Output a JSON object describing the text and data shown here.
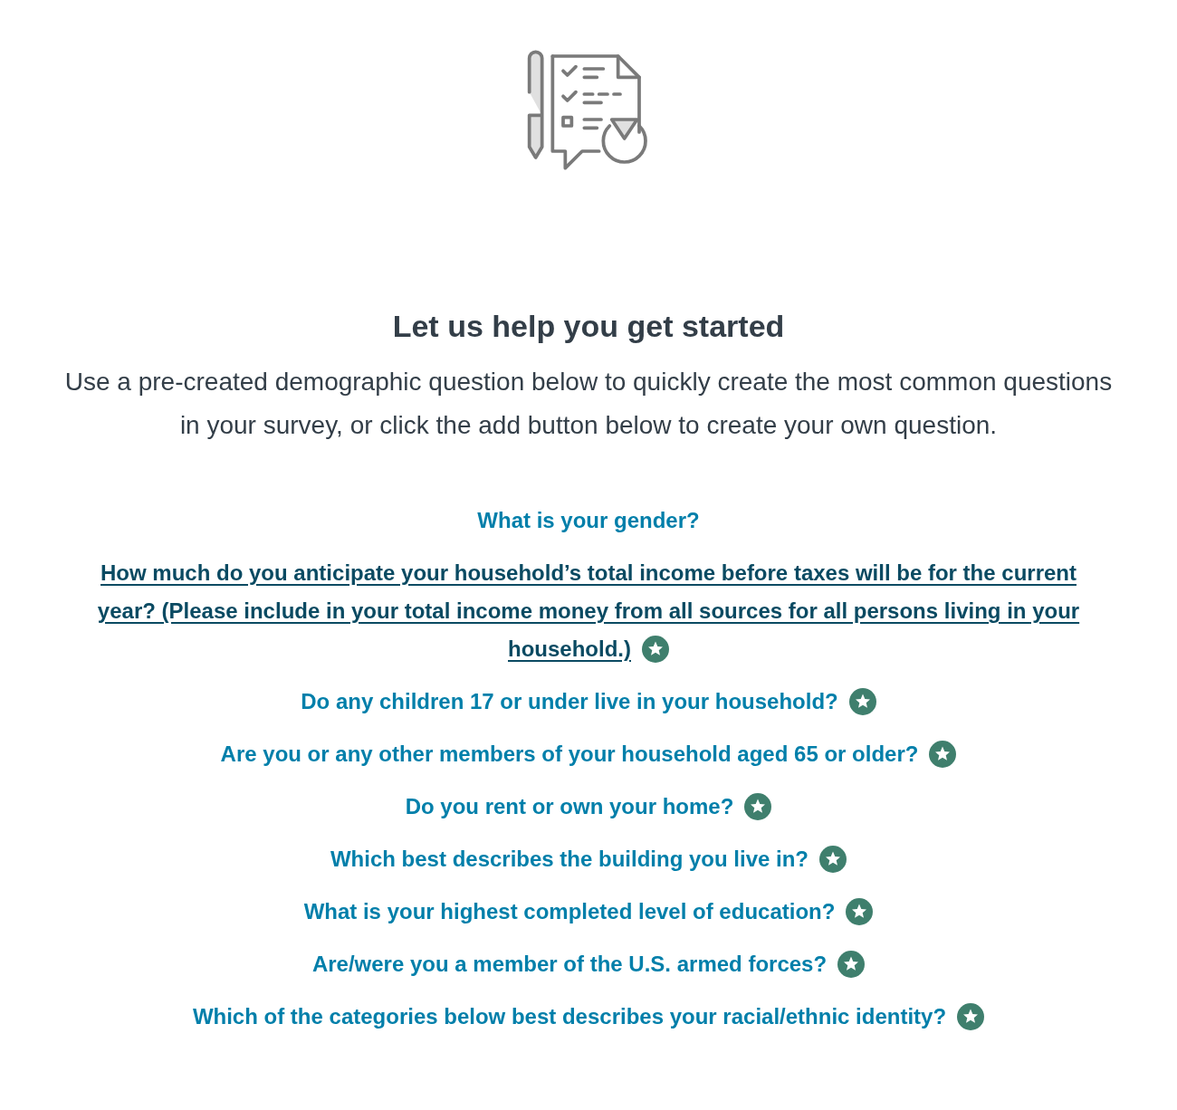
{
  "heading": "Let us help you get started",
  "intro": "Use a pre-created demographic question below to quickly create the most common questions in your survey, or click the add button below to create your own question.",
  "questions": [
    {
      "text": "What is your gender?",
      "hovered": false,
      "starred": false
    },
    {
      "text": "How much do you anticipate your household’s total income before taxes will be for the current year? (Please include in your total income money from all sources for all persons living in your household.)",
      "hovered": true,
      "starred": true
    },
    {
      "text": "Do any children 17 or under live in your household?",
      "hovered": false,
      "starred": true
    },
    {
      "text": "Are you or any other members of your household aged 65 or older?",
      "hovered": false,
      "starred": true
    },
    {
      "text": "Do you rent or own your home?",
      "hovered": false,
      "starred": true
    },
    {
      "text": "Which best describes the building you live in?",
      "hovered": false,
      "starred": true
    },
    {
      "text": "What is your highest completed level of education?",
      "hovered": false,
      "starred": true
    },
    {
      "text": "Are/were you a member of the U.S. armed forces?",
      "hovered": false,
      "starred": true
    },
    {
      "text": "Which of the categories below best describes your racial/ethnic identity?",
      "hovered": false,
      "starred": true
    }
  ]
}
